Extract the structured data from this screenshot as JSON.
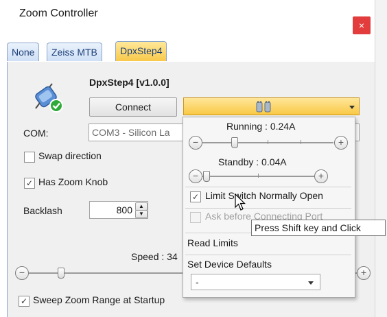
{
  "window": {
    "title": "Zoom Controller",
    "close_label": "×"
  },
  "tabs": [
    {
      "label": "None",
      "active": false
    },
    {
      "label": "Zeiss MTB",
      "active": false
    },
    {
      "label": "DpxStep4",
      "active": true
    }
  ],
  "device": {
    "title": "DpxStep4 [v1.0.0]",
    "icon": "connector-plug-checkmark-icon",
    "connect_label": "Connect",
    "settings_icon": "connector-pins-icon"
  },
  "com": {
    "label": "COM:",
    "value": "COM3 - Silicon La"
  },
  "options": {
    "swap_direction": {
      "label": "Swap direction",
      "checked": false
    },
    "has_zoom_knob": {
      "label": "Has Zoom Knob",
      "checked": true
    },
    "sweep_zoom": {
      "label": "Sweep Zoom Range at Startup",
      "checked": true
    }
  },
  "backlash": {
    "label": "Backlash",
    "value": "800"
  },
  "speed": {
    "label": "Speed : 34"
  },
  "dropdown": {
    "running": {
      "label": "Running : 0.24A",
      "level": 0.2
    },
    "standby": {
      "label": "Standby : 0.04A",
      "level": 0.05
    },
    "limit_switch": {
      "label": "Limit Switch Normally Open",
      "checked": true
    },
    "ask_before": {
      "label": "Ask before Connecting Port",
      "checked": false,
      "enabled": false
    },
    "read_limits": "Read Limits",
    "set_defaults": "Set Device Defaults",
    "defaults_value": "-"
  },
  "tooltip": "Press Shift key and Click",
  "colors": {
    "accent": "#f8c94a",
    "close": "#e23c3c",
    "check_green": "#2eaa3b"
  }
}
